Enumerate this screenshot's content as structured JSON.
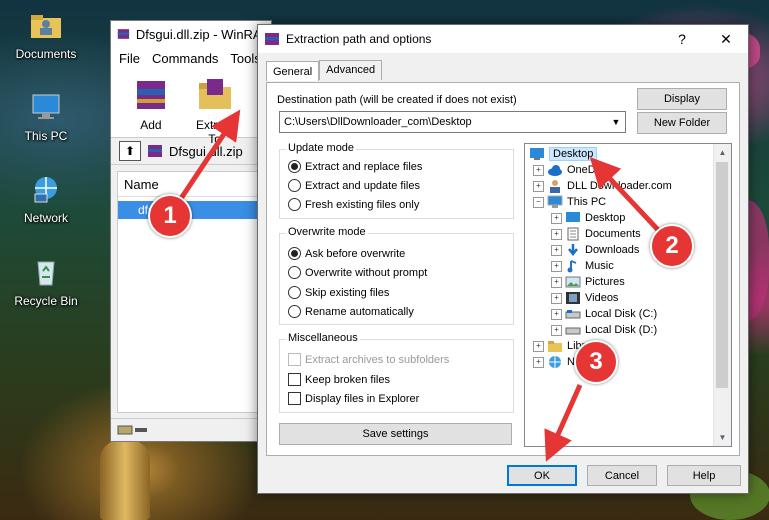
{
  "desktop": {
    "icons": [
      {
        "label": "Documents",
        "icon": "folder-user-icon"
      },
      {
        "label": "This PC",
        "icon": "computer-icon"
      },
      {
        "label": "Network",
        "icon": "network-icon"
      },
      {
        "label": "Recycle Bin",
        "icon": "recycle-bin-icon"
      }
    ]
  },
  "winrar": {
    "title": "Dfsgui.dll.zip - WinRAR",
    "menu": [
      "File",
      "Commands",
      "Tools"
    ],
    "tools": [
      {
        "label": "Add"
      },
      {
        "label": "Extract To"
      },
      {
        "label": "T"
      }
    ],
    "path": "Dfsgui.dll.zip",
    "list_header": "Name",
    "file": "dfsgui.dll"
  },
  "dialog": {
    "title": "Extraction path and options",
    "help": "?",
    "close": "✕",
    "tabs": [
      "General",
      "Advanced"
    ],
    "dest_label": "Destination path (will be created if does not exist)",
    "dest_value": "C:\\Users\\DllDownloader_com\\Desktop",
    "display_btn": "Display",
    "new_folder_btn": "New Folder",
    "update_mode": {
      "title": "Update mode",
      "options": [
        "Extract and replace files",
        "Extract and update files",
        "Fresh existing files only"
      ]
    },
    "overwrite_mode": {
      "title": "Overwrite mode",
      "options": [
        "Ask before overwrite",
        "Overwrite without prompt",
        "Skip existing files",
        "Rename automatically"
      ]
    },
    "misc": {
      "title": "Miscellaneous",
      "options": [
        "Extract archives to subfolders",
        "Keep broken files",
        "Display files in Explorer"
      ]
    },
    "save_btn": "Save settings",
    "tree": [
      {
        "label": "Desktop",
        "icon": "desktop-icon"
      },
      {
        "label": "OneDrive",
        "icon": "onedrive-icon"
      },
      {
        "label": "DLL Downloader.com",
        "icon": "user-icon"
      },
      {
        "label": "This PC",
        "icon": "computer-icon"
      },
      {
        "label": "Desktop",
        "icon": "desktop-icon"
      },
      {
        "label": "Documents",
        "icon": "documents-icon"
      },
      {
        "label": "Downloads",
        "icon": "downloads-icon"
      },
      {
        "label": "Music",
        "icon": "music-icon"
      },
      {
        "label": "Pictures",
        "icon": "pictures-icon"
      },
      {
        "label": "Videos",
        "icon": "videos-icon"
      },
      {
        "label": "Local Disk (C:)",
        "icon": "disk-icon"
      },
      {
        "label": "Local Disk (D:)",
        "icon": "disk-icon"
      },
      {
        "label": "Libr",
        "icon": "libraries-icon"
      },
      {
        "label": "Ne",
        "icon": "network-icon"
      }
    ],
    "ok_btn": "OK",
    "cancel_btn": "Cancel",
    "help_btn": "Help"
  },
  "annotations": [
    "1",
    "2",
    "3"
  ],
  "colors": {
    "badge": "#e53535",
    "selection": "#cce8ff",
    "file_highlight": "#3a8ee6"
  }
}
